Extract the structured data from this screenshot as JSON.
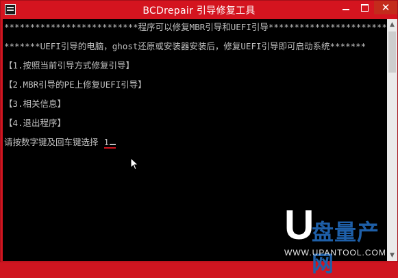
{
  "window": {
    "title": "BCDrepair 引导修复工具",
    "icon": "console-app-icon"
  },
  "controls": {
    "minimize": "minimize",
    "maximize": "maximize",
    "close": "✕"
  },
  "console": {
    "lines": [
      "**************************程序可以修复MBR引导和UEFI引导**************************",
      "*******UEFI引导的电脑，ghost还原或安装器安装后，修复UEFI引导即可启动系统*******",
      "【1.按照当前引导方式修复引导】",
      "【2.MBR引导的PE上修复UEFI引导】",
      "【3.相关信息】",
      "【4.退出程序】"
    ],
    "prompt": "请按数字键及回车键选择",
    "input_value": "1"
  },
  "watermark": {
    "logo": "U",
    "brand": "盘量产网",
    "url": "WWW.UPANTOOL.COM"
  },
  "colors": {
    "title_bar": "#d4141f",
    "console_bg": "#000000",
    "console_text": "#c0c0c0"
  }
}
